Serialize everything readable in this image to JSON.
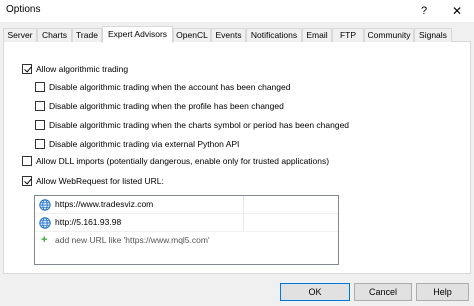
{
  "window": {
    "title": "Options",
    "help_glyph": "?",
    "close_glyph": "✕"
  },
  "tabs": [
    {
      "label": "Server"
    },
    {
      "label": "Charts"
    },
    {
      "label": "Trade"
    },
    {
      "label": "Expert Advisors"
    },
    {
      "label": "OpenCL"
    },
    {
      "label": "Events"
    },
    {
      "label": "Notifications"
    },
    {
      "label": "Email"
    },
    {
      "label": "FTP"
    },
    {
      "label": "Community"
    },
    {
      "label": "Signals"
    }
  ],
  "active_tab": "Expert Advisors",
  "settings": {
    "allow_algo": {
      "label": "Allow algorithmic trading",
      "checked": true
    },
    "disable_account": {
      "label": "Disable algorithmic trading when the account has been changed",
      "checked": false
    },
    "disable_profile": {
      "label": "Disable algorithmic trading when the profile has been changed",
      "checked": false
    },
    "disable_symbol": {
      "label": "Disable algorithmic trading when the charts symbol or period has been changed",
      "checked": false
    },
    "disable_python": {
      "label": "Disable algorithmic trading via external Python API",
      "checked": false
    },
    "allow_dll": {
      "label": "Allow DLL imports (potentially dangerous, enable only for trusted applications)",
      "checked": false
    },
    "allow_webrequest": {
      "label": "Allow WebRequest for listed URL:",
      "checked": true
    }
  },
  "url_list": {
    "urls": [
      "https://www.tradesviz.com",
      "http://5.161.93.98"
    ],
    "add_placeholder": "add new URL like 'https://www.mql5.com'",
    "add_glyph": "+"
  },
  "buttons": {
    "ok": "OK",
    "cancel": "Cancel",
    "help": "Help"
  },
  "colors": {
    "accent": "#0078d7",
    "globe": "#1e6fc8",
    "add": "#3aa83a"
  }
}
